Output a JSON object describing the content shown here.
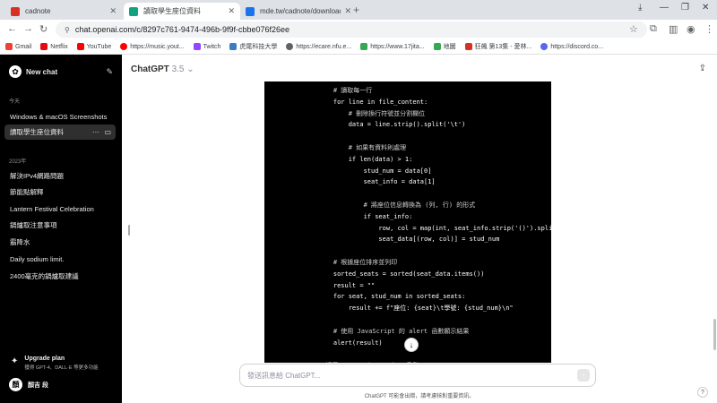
{
  "browser": {
    "tabs": [
      {
        "title": "cadnote",
        "color": "#d93025",
        "active": false
      },
      {
        "title": "讀取學生座位資料",
        "color": "#10a37f",
        "active": true
      },
      {
        "title": "mde.tw/cadnote/downloads/...",
        "color": "#1a73e8",
        "active": false
      }
    ],
    "url": "chat.openai.com/c/8297c761-9474-496b-9f9f-cbbe076f26ee",
    "bookmarks": [
      {
        "label": "Gmail",
        "color": "#ea4335"
      },
      {
        "label": "Netflix",
        "color": "#e50914"
      },
      {
        "label": "YouTube",
        "color": "#ff0000"
      },
      {
        "label": "https://music.yout...",
        "color": "#ff0000"
      },
      {
        "label": "Twitch",
        "color": "#9146ff"
      },
      {
        "label": "虎尾科技大學",
        "color": "#3c7cc4"
      },
      {
        "label": "https://ecare.nfu.e...",
        "color": "#5f6368"
      },
      {
        "label": "https://www.17jita...",
        "color": "#34a853"
      },
      {
        "label": "地圖",
        "color": "#34a853"
      },
      {
        "label": "狂飆 第13集 - 愛林...",
        "color": "#d93025"
      },
      {
        "label": "https://discord.co...",
        "color": "#5865f2"
      }
    ]
  },
  "sidebar": {
    "new_chat": "New chat",
    "groups": [
      {
        "title": "今天",
        "items": [
          "Windows & macOS Screenshots",
          "讀取學生座位資料"
        ]
      },
      {
        "title": "2023年",
        "items": [
          "解決IPv4網路問題",
          "節能點解釋",
          "Lantern Festival Celebration",
          "鍋爐取注意事項",
          "霸降水",
          "Daily sodium limit.",
          "2400毫克的鍋爐取建議"
        ]
      }
    ],
    "upgrade_title": "Upgrade plan",
    "upgrade_sub": "獲得 GPT-4、DALL·E 等更多功能",
    "user_initial": "顏",
    "user_name": "顏吉 段"
  },
  "main": {
    "model": "ChatGPT",
    "version": "3.5",
    "code_lines": [
      "    # 讀取每一行",
      "    for line in file_content:",
      "        # 刪除換行符號並分割欄位",
      "        data = line.strip().split('\\t')",
      "",
      "        # 如果有資料則處理",
      "        if len(data) > 1:",
      "            stud_num = data[0]",
      "            seat_info = data[1]",
      "",
      "            # 將座位信息轉換為 (列, 行) 的形式",
      "            if seat_info:",
      "                row, col = map(int, seat_info.strip('()').split(",
      "                seat_data[(row, col)] = stud_num",
      "",
      "    # 根據座位排序並列印",
      "    sorted_seats = sorted(seat_data.items())",
      "    result = \"\"",
      "    for seat, stud_num in sorted_seats:",
      "        result += f\"座位: {seat}\\t學號: {stud_num}\\n\"",
      "",
      "    # 使用 JavaScript 的 alert 函數顯示結果",
      "    alert(result)",
      "",
      "# 調用 runBrythonScript 函數"
    ],
    "composer_placeholder": "發送訊息給 ChatGPT...",
    "disclaimer": "ChatGPT 可能會出錯，請考慮核對重要資訊。"
  }
}
